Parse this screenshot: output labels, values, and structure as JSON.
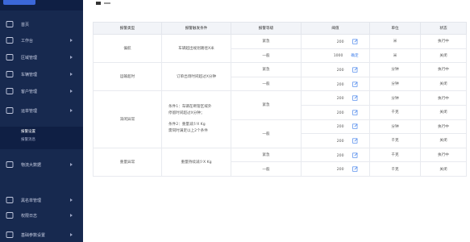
{
  "sidebar": {
    "items": [
      {
        "label": "首页",
        "icon": "home-icon"
      },
      {
        "label": "工作台",
        "icon": "monitor-icon"
      },
      {
        "label": "区域管理",
        "icon": "region-icon"
      },
      {
        "label": "车辆管理",
        "icon": "truck-icon"
      },
      {
        "label": "客户管理",
        "icon": "user-icon"
      },
      {
        "label": "运单管理",
        "icon": "waybill-icon"
      },
      {
        "label": "报警管理",
        "icon": "alarm-icon"
      },
      {
        "label": "物流大数据",
        "icon": "data-icon"
      },
      {
        "label": "黑名单管理",
        "icon": "blacklist-icon"
      },
      {
        "label": "权限日志",
        "icon": "log-icon"
      },
      {
        "label": "基础参数设置",
        "icon": "settings-icon"
      }
    ],
    "sub_items": [
      "报警设置",
      "报警消息"
    ]
  },
  "table": {
    "headers": [
      "报警类型",
      "报警触发条件",
      "报警等级",
      "阈值",
      "单位",
      "状态"
    ],
    "groups": [
      {
        "type": "偏航",
        "condition": [
          "车辆超出规划路径X米"
        ],
        "rows": [
          {
            "level": "紧急",
            "threshold": "200",
            "action": "",
            "unit": "米",
            "status": "执行中"
          },
          {
            "level": "一般",
            "threshold": "1000",
            "action": "确定",
            "unit": "米",
            "status": "关闭"
          }
        ]
      },
      {
        "type": "运输超时",
        "condition": [
          "订单出场时间超过X分钟"
        ],
        "rows": [
          {
            "level": "紧急",
            "threshold": "200",
            "action": "",
            "unit": "分钟",
            "status": "执行中"
          },
          {
            "level": "一般",
            "threshold": "200",
            "action": "",
            "unit": "分钟",
            "status": "关闭"
          }
        ]
      },
      {
        "type": "滞闲异常",
        "condition": [
          "条件1：车辆在断管区域外",
          "停留时间超过X分钟；",
          "",
          "条件2：重量减少X Kg",
          "需同时满足以上2个条件"
        ],
        "rows": [
          {
            "level": "紧急",
            "threshold": "200",
            "action": "",
            "unit": "分钟",
            "status": "执行中"
          },
          {
            "level": "",
            "threshold": "200",
            "action": "",
            "unit": "千克",
            "status": "关闭"
          },
          {
            "level": "一般",
            "threshold": "200",
            "action": "",
            "unit": "分钟",
            "status": "执行中"
          },
          {
            "level": "",
            "threshold": "200",
            "action": "",
            "unit": "千克",
            "status": "关闭"
          }
        ]
      },
      {
        "type": "重量异常",
        "condition": [
          "重量持续减少X Kg"
        ],
        "rows": [
          {
            "level": "紧急",
            "threshold": "200",
            "action": "",
            "unit": "千克",
            "status": "执行中"
          },
          {
            "level": "一般",
            "threshold": "200",
            "action": "",
            "unit": "千克",
            "status": "关闭"
          }
        ]
      }
    ]
  },
  "colors": {
    "sidebar_bg": "#17294f",
    "sidebar_active_bg": "#0f1f44",
    "accent": "#3a7bea"
  }
}
